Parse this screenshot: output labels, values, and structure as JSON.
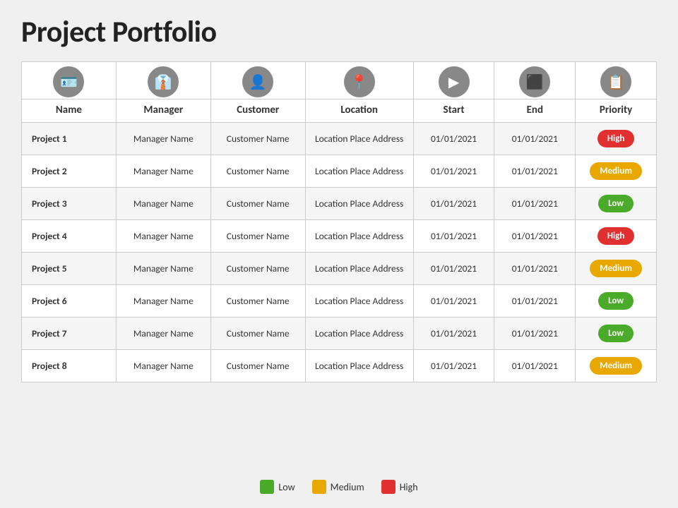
{
  "title": "Project Portfolio",
  "columns": [
    {
      "id": "name",
      "label": "Name",
      "icon": "🪪"
    },
    {
      "id": "manager",
      "label": "Manager",
      "icon": "👔"
    },
    {
      "id": "customer",
      "label": "Customer",
      "icon": "👤"
    },
    {
      "id": "location",
      "label": "Location",
      "icon": "📍"
    },
    {
      "id": "start",
      "label": "Start",
      "icon": "▶"
    },
    {
      "id": "end",
      "label": "End",
      "icon": "⬛"
    },
    {
      "id": "priority",
      "label": "Priority",
      "icon": "📋"
    }
  ],
  "rows": [
    {
      "name": "Project 1",
      "manager": "Manager Name",
      "customer": "Customer  Name",
      "location": "Location Place Address",
      "start": "01/01/2021",
      "end": "01/01/2021",
      "priority": "High",
      "priorityClass": "priority-high"
    },
    {
      "name": "Project 2",
      "manager": "Manager Name",
      "customer": "Customer  Name",
      "location": "Location Place Address",
      "start": "01/01/2021",
      "end": "01/01/2021",
      "priority": "Medium",
      "priorityClass": "priority-medium"
    },
    {
      "name": "Project 3",
      "manager": "Manager Name",
      "customer": "Customer  Name",
      "location": "Location Place Address",
      "start": "01/01/2021",
      "end": "01/01/2021",
      "priority": "Low",
      "priorityClass": "priority-low"
    },
    {
      "name": "Project 4",
      "manager": "Manager Name",
      "customer": "Customer  Name",
      "location": "Location Place Address",
      "start": "01/01/2021",
      "end": "01/01/2021",
      "priority": "High",
      "priorityClass": "priority-high"
    },
    {
      "name": "Project 5",
      "manager": "Manager Name",
      "customer": "Customer  Name",
      "location": "Location Place Address",
      "start": "01/01/2021",
      "end": "01/01/2021",
      "priority": "Medium",
      "priorityClass": "priority-medium"
    },
    {
      "name": "Project 6",
      "manager": "Manager Name",
      "customer": "Customer  Name",
      "location": "Location Place Address",
      "start": "01/01/2021",
      "end": "01/01/2021",
      "priority": "Low",
      "priorityClass": "priority-low"
    },
    {
      "name": "Project 7",
      "manager": "Manager Name",
      "customer": "Customer  Name",
      "location": "Location Place Address",
      "start": "01/01/2021",
      "end": "01/01/2021",
      "priority": "Low",
      "priorityClass": "priority-low"
    },
    {
      "name": "Project 8",
      "manager": "Manager Name",
      "customer": "Customer  Name",
      "location": "Location Place Address",
      "start": "01/01/2021",
      "end": "01/01/2021",
      "priority": "Medium",
      "priorityClass": "priority-medium"
    }
  ],
  "legend": [
    {
      "label": "Low",
      "colorClass": "legend-low"
    },
    {
      "label": "Medium",
      "colorClass": "legend-medium"
    },
    {
      "label": "High",
      "colorClass": "legend-high"
    }
  ]
}
